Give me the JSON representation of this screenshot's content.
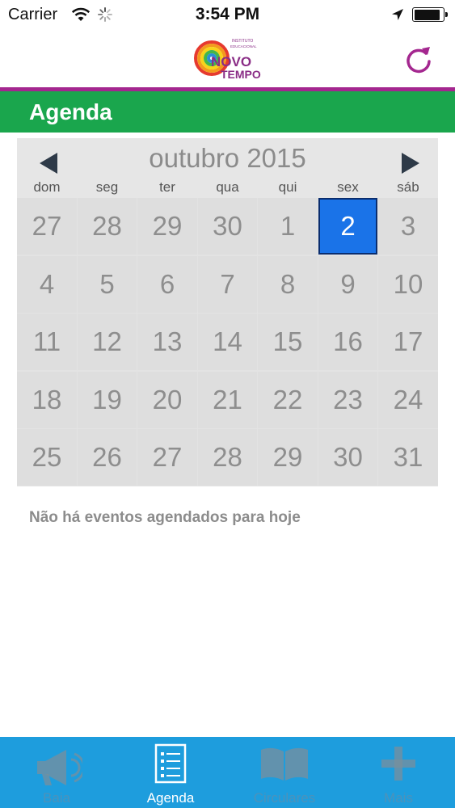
{
  "status_bar": {
    "carrier": "Carrier",
    "time": "3:54 PM",
    "battery_level": 0.9
  },
  "nav": {
    "logo_text": [
      "INSTITUTO",
      "EDUCACIONAL",
      "NOVO",
      "TEMPO"
    ],
    "accent_color": "#a4278f"
  },
  "section": {
    "title": "Agenda",
    "color": "#1aa64d"
  },
  "calendar": {
    "month_title": "outubro 2015",
    "weekdays": [
      "dom",
      "seg",
      "ter",
      "qua",
      "qui",
      "sex",
      "sáb"
    ],
    "weeks": [
      [
        "27",
        "28",
        "29",
        "30",
        "1",
        "2",
        "3"
      ],
      [
        "4",
        "5",
        "6",
        "7",
        "8",
        "9",
        "10"
      ],
      [
        "11",
        "12",
        "13",
        "14",
        "15",
        "16",
        "17"
      ],
      [
        "18",
        "19",
        "20",
        "21",
        "22",
        "23",
        "24"
      ],
      [
        "25",
        "26",
        "27",
        "28",
        "29",
        "30",
        "31"
      ]
    ],
    "selected_day": "2",
    "selected_color": "#1a73e8"
  },
  "events": {
    "empty_message": "Não há eventos agendados para hoje"
  },
  "tab_bar": {
    "color": "#1e9ddd",
    "tabs": [
      {
        "label": "Baia",
        "icon": "megaphone-icon",
        "active": false
      },
      {
        "label": "Agenda",
        "icon": "list-icon",
        "active": true
      },
      {
        "label": "Circulares",
        "icon": "book-icon",
        "active": false
      },
      {
        "label": "Mais",
        "icon": "plus-icon",
        "active": false
      }
    ]
  }
}
